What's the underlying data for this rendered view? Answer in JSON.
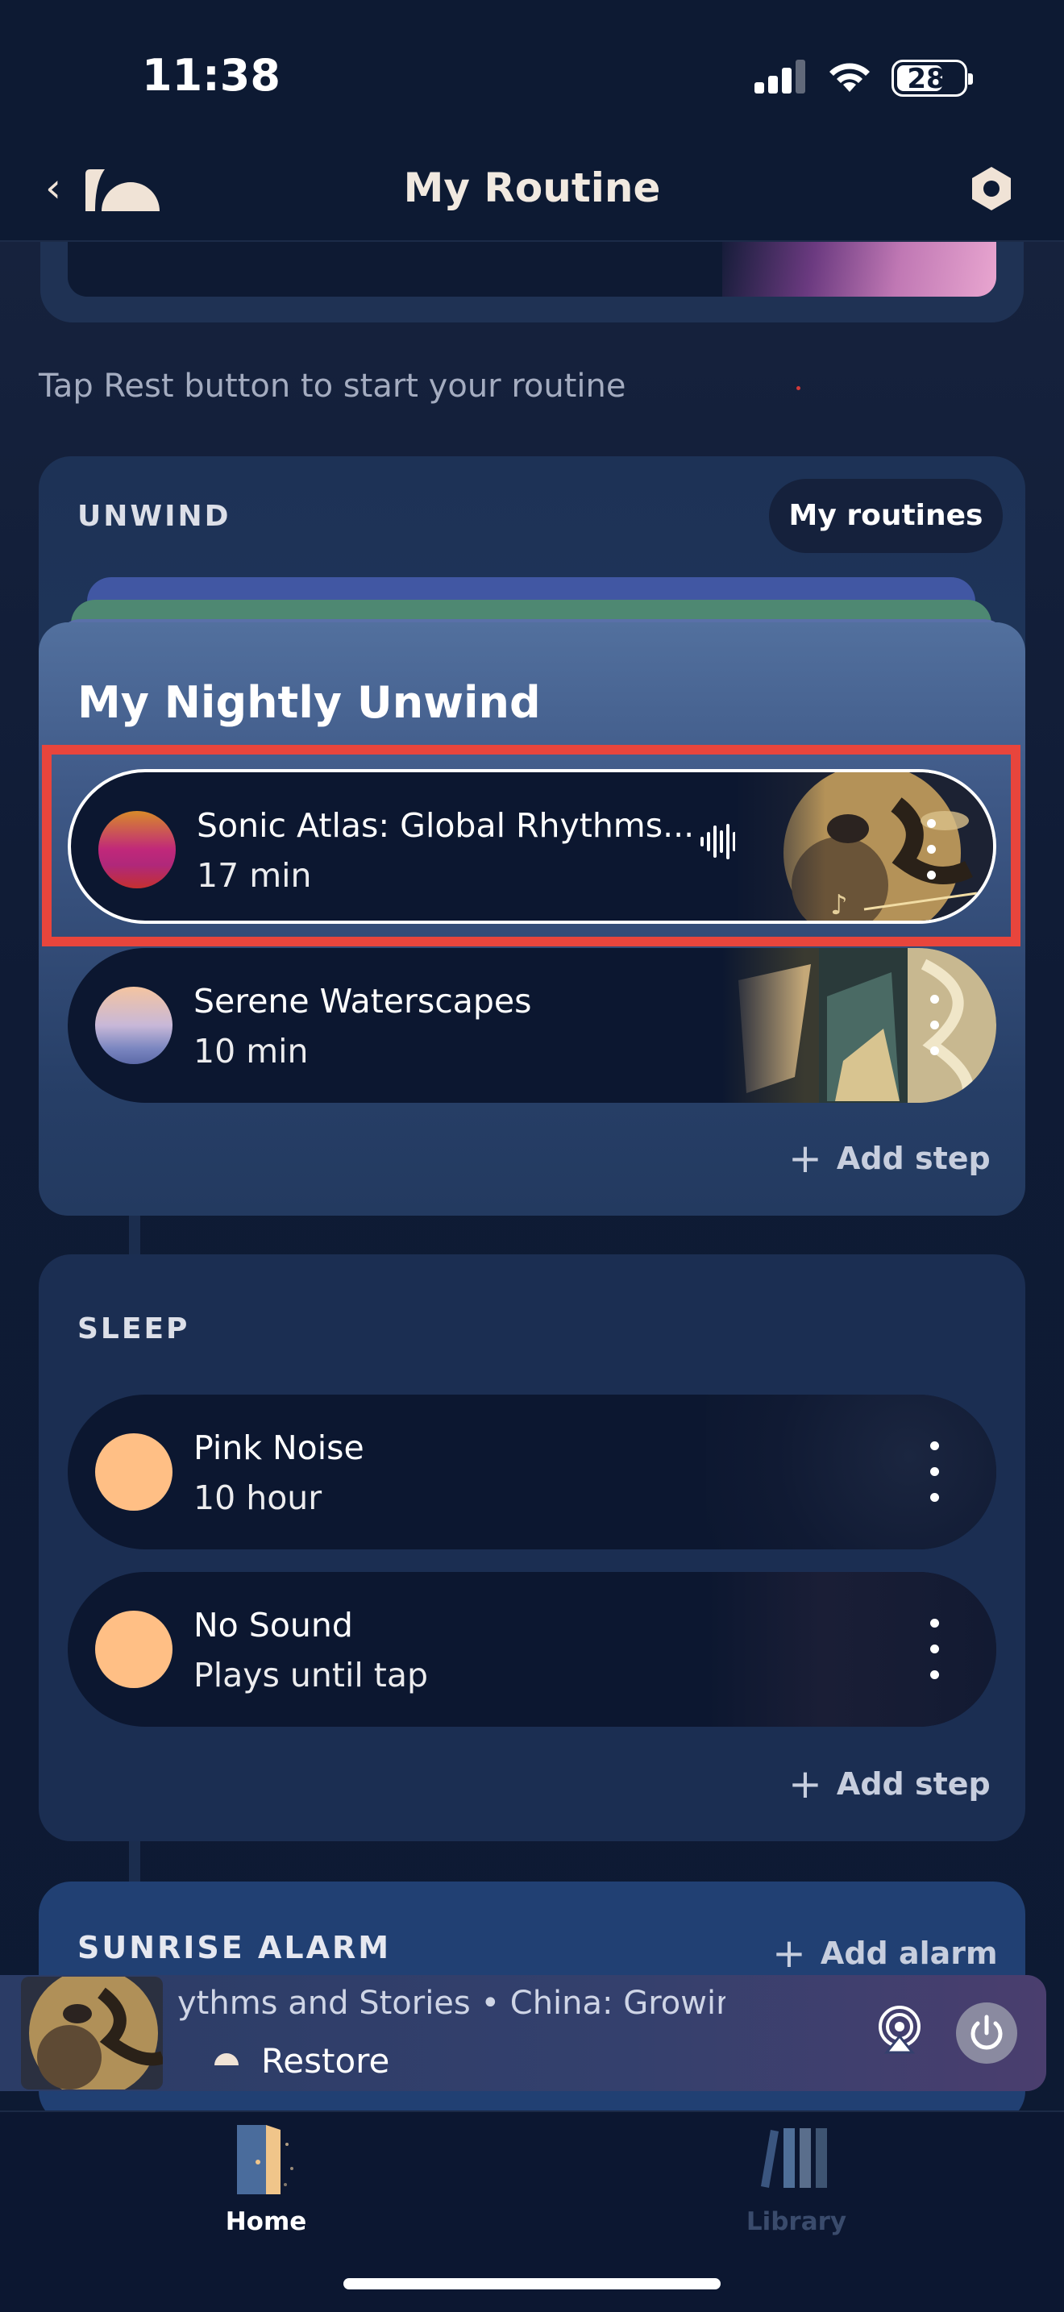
{
  "status_bar": {
    "time": "11:38",
    "battery": "28"
  },
  "header": {
    "title": "My Routine"
  },
  "hint": "Tap Rest button to start your routine",
  "unwind": {
    "label": "UNWIND",
    "my_routines_label": "My routines",
    "routine_name": "My Nightly Unwind",
    "items": [
      {
        "title": "Sonic Atlas: Global Rhythms...",
        "duration": "17 min"
      },
      {
        "title": "Serene Waterscapes",
        "duration": "10 min"
      }
    ],
    "add_step_label": "Add step"
  },
  "sleep": {
    "label": "SLEEP",
    "items": [
      {
        "title": "Pink Noise",
        "duration": "10 hour"
      },
      {
        "title": "No Sound",
        "duration": "Plays until tap"
      }
    ],
    "add_step_label": "Add step"
  },
  "sunrise": {
    "label": "SUNRISE ALARM",
    "add_alarm_label": "Add alarm"
  },
  "player": {
    "track": "ythms and Stories • China: Growir",
    "status": "Restore"
  },
  "tabs": [
    {
      "label": "Home",
      "active": true
    },
    {
      "label": "Library",
      "active": false
    }
  ],
  "colors": {
    "accent_highlight": "#e8453c",
    "peach": "#ffbf85",
    "background": "#0d1a33"
  }
}
